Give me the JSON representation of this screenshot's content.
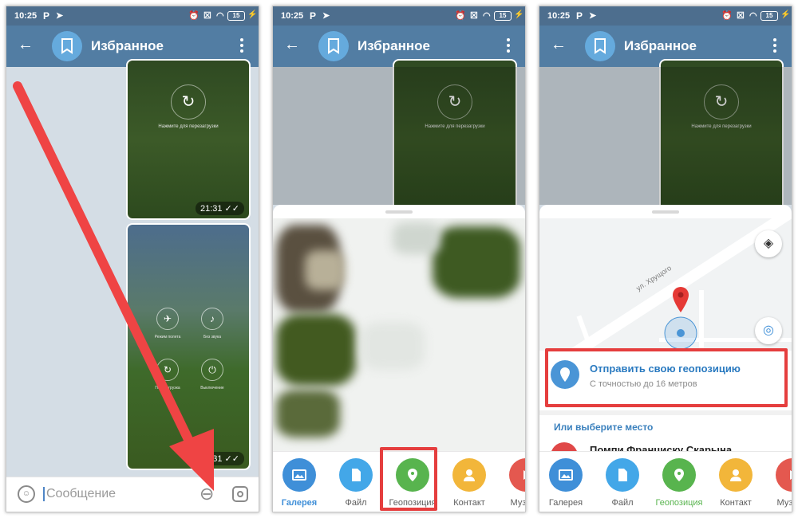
{
  "status": {
    "time": "10:25",
    "battery": "15"
  },
  "chat": {
    "title": "Избранное",
    "input_placeholder": "Сообщение"
  },
  "media": [
    {
      "caption": "Нажмите для перезагрузки",
      "time": "21:31"
    },
    {
      "time": "21:31",
      "tiles": [
        "Режим полета",
        "Без звука",
        "Перезагрузка",
        "Выключение"
      ]
    }
  ],
  "attach_menu": {
    "items": [
      "Галерея",
      "Файл",
      "Геопозиция",
      "Контакт",
      "Музыка"
    ]
  },
  "location": {
    "street": "ул. Хрущого",
    "send_title": "Отправить свою геопозицию",
    "send_subtitle": "С точностью до 16 метров",
    "or_choose": "Или выберите место",
    "place": "Помпи Франциску Скарына"
  },
  "colors": {
    "accent": "#527da3",
    "highlight": "#e53e3e",
    "arrow": "#ef4444"
  },
  "icons": [
    "back-arrow-icon",
    "bookmark-icon",
    "more-vert-icon",
    "smile-icon",
    "paperclip-icon",
    "camera-icon",
    "image-icon",
    "file-icon",
    "location-pin-icon",
    "contact-icon",
    "music-icon",
    "layers-icon",
    "my-location-icon"
  ]
}
